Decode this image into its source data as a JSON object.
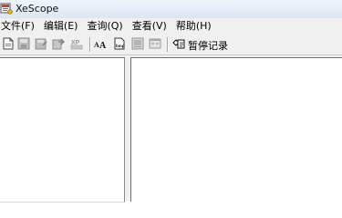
{
  "window": {
    "title": "XeScope",
    "icon": "xescope-app-icon"
  },
  "menu": {
    "items": [
      {
        "label": "文件(F)"
      },
      {
        "label": "编辑(E)"
      },
      {
        "label": "查询(Q)"
      },
      {
        "label": "查看(V)"
      },
      {
        "label": "帮助(H)"
      }
    ]
  },
  "toolbar": {
    "icons": [
      "open-file-icon",
      "save-icon",
      "save-as-icon",
      "export-icon",
      "xp-theme-icon",
      "font-aa-icon",
      "bmp-icon",
      "image-resource-icon",
      "dialog-resource-icon",
      "record-icon"
    ],
    "record_label": "暂停记录"
  },
  "colors": {
    "titlebar": "#dbe6f3",
    "chrome": "#f0f0f0",
    "pane_background": "#ffffff"
  }
}
